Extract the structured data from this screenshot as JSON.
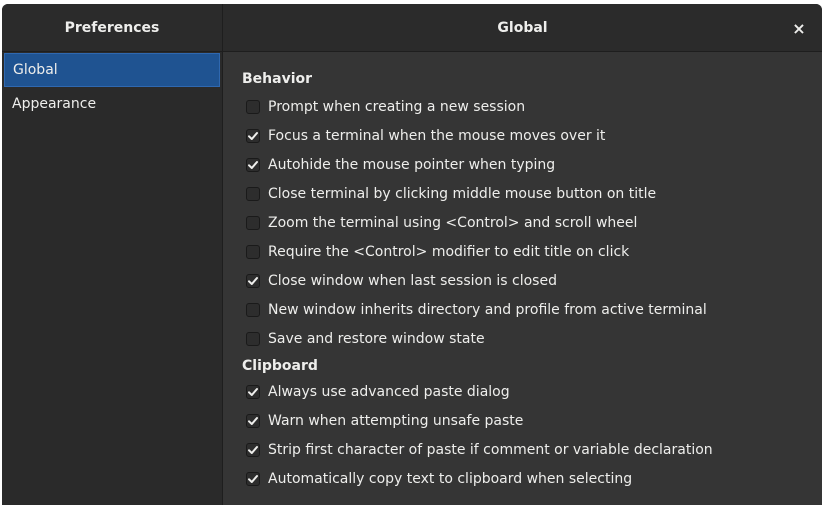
{
  "header": {
    "sidebar_title": "Preferences",
    "content_title": "Global",
    "close_glyph": "×"
  },
  "sidebar": {
    "items": [
      {
        "label": "Global",
        "selected": true
      },
      {
        "label": "Appearance",
        "selected": false
      }
    ]
  },
  "behavior": {
    "title": "Behavior",
    "options": [
      {
        "label": "Prompt when creating a new session",
        "checked": false
      },
      {
        "label": "Focus a terminal when the mouse moves over it",
        "checked": true
      },
      {
        "label": "Autohide the mouse pointer when typing",
        "checked": true
      },
      {
        "label": "Close terminal by clicking middle mouse button on title",
        "checked": false
      },
      {
        "label": "Zoom the terminal using <Control> and scroll wheel",
        "checked": false
      },
      {
        "label": "Require the <Control> modifier to edit title on click",
        "checked": false
      },
      {
        "label": "Close window when last session is closed",
        "checked": true
      },
      {
        "label": "New window inherits directory and profile from active terminal",
        "checked": false
      },
      {
        "label": "Save and restore window state",
        "checked": false
      }
    ]
  },
  "clipboard": {
    "title": "Clipboard",
    "options": [
      {
        "label": "Always use advanced paste dialog",
        "checked": true
      },
      {
        "label": "Warn when attempting unsafe paste",
        "checked": true
      },
      {
        "label": "Strip first character of paste if comment or variable declaration",
        "checked": true
      },
      {
        "label": "Automatically copy text to clipboard when selecting",
        "checked": true
      }
    ]
  },
  "colors": {
    "background": "#353535",
    "sidebar": "#2a2a2a",
    "headerbar": "#2b2b2b",
    "selection": "#1f5391",
    "text": "#eeeeec"
  },
  "icons": {
    "close": "close-icon",
    "check": "checkmark-icon"
  }
}
